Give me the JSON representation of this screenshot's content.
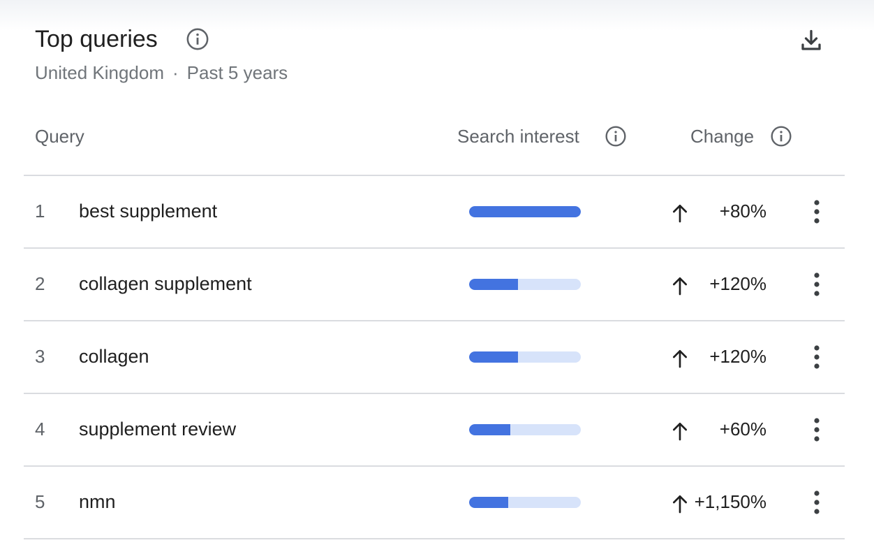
{
  "header": {
    "title": "Top queries",
    "location": "United Kingdom",
    "separator": "·",
    "period": "Past 5 years"
  },
  "icons": {
    "title_info": "info-icon",
    "download": "download-icon",
    "more": "more-vert-icon",
    "trend_up": "arrow-up-icon"
  },
  "colors": {
    "bar_fill": "#4373e0",
    "bar_track": "#d7e3fa",
    "muted_text": "#70757a"
  },
  "table": {
    "columns": {
      "query": "Query",
      "search_interest": "Search interest",
      "change": "Change"
    },
    "rows": [
      {
        "rank": "1",
        "query": "best supplement",
        "interest": 100,
        "change": "+80%"
      },
      {
        "rank": "2",
        "query": "collagen supplement",
        "interest": 44,
        "change": "+120%"
      },
      {
        "rank": "3",
        "query": "collagen",
        "interest": 44,
        "change": "+120%"
      },
      {
        "rank": "4",
        "query": "supplement review",
        "interest": 37,
        "change": "+60%"
      },
      {
        "rank": "5",
        "query": "nmn",
        "interest": 35,
        "change": "+1,150%"
      }
    ]
  }
}
